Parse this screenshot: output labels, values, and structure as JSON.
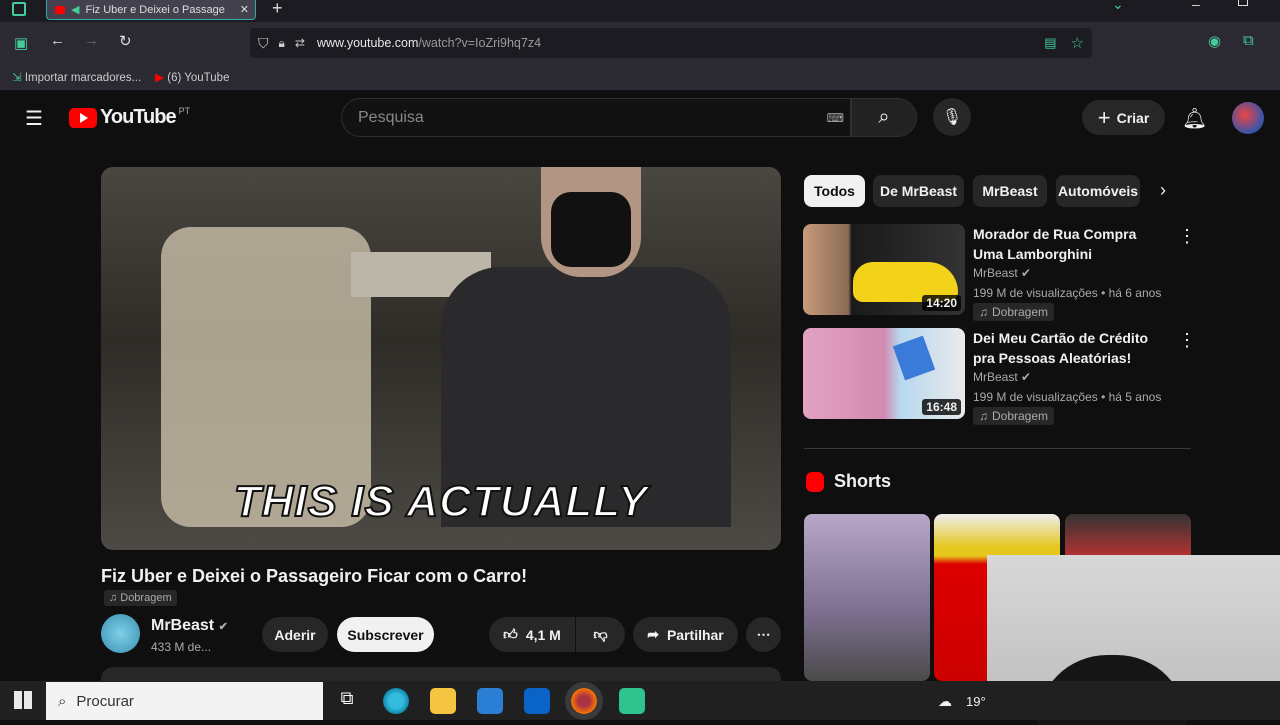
{
  "browser": {
    "tab_title": "Fiz Uber e Deixei o Passage",
    "url_host": "www.youtube.com",
    "url_path": "/watch?v=IoZri9hq7z4",
    "bookmarks": [
      "Importar marcadores...",
      "(6) YouTube"
    ]
  },
  "youtube": {
    "logo_text": "YouTube",
    "region": "PT",
    "search_placeholder": "Pesquisa",
    "create_label": "Criar"
  },
  "video": {
    "caption": "THIS IS ACTUALLY",
    "title": "Fiz Uber e Deixei o Passageiro Ficar com o Carro!",
    "dub_label": "Dobragem",
    "channel_name": "MrBeast",
    "subscribers": "433 M de...",
    "join_label": "Aderir",
    "subscribe_label": "Subscrever",
    "likes": "4,1 M",
    "share_label": "Partilhar"
  },
  "chips": [
    "Todos",
    "De MrBeast",
    "MrBeast",
    "Automóveis"
  ],
  "recommendations": [
    {
      "title": "Morador de Rua Compra Uma Lamborghini",
      "channel": "MrBeast",
      "meta": "199 M de visualizações • há 6 anos",
      "badge": "Dobragem",
      "duration": "14:20"
    },
    {
      "title": "Dei Meu Cartão de Crédito pra Pessoas Aleatórias!",
      "channel": "MrBeast",
      "meta": "199 M de visualizações • há 5 anos",
      "badge": "Dobragem",
      "duration": "16:48"
    }
  ],
  "shorts": {
    "title": "Shorts"
  },
  "taskbar": {
    "search_placeholder": "Procurar",
    "weather": "19°"
  },
  "colors": {
    "yt_red": "#ff0000",
    "bg": "#0f0f0f",
    "chip_active_bg": "#f1f1f1"
  }
}
